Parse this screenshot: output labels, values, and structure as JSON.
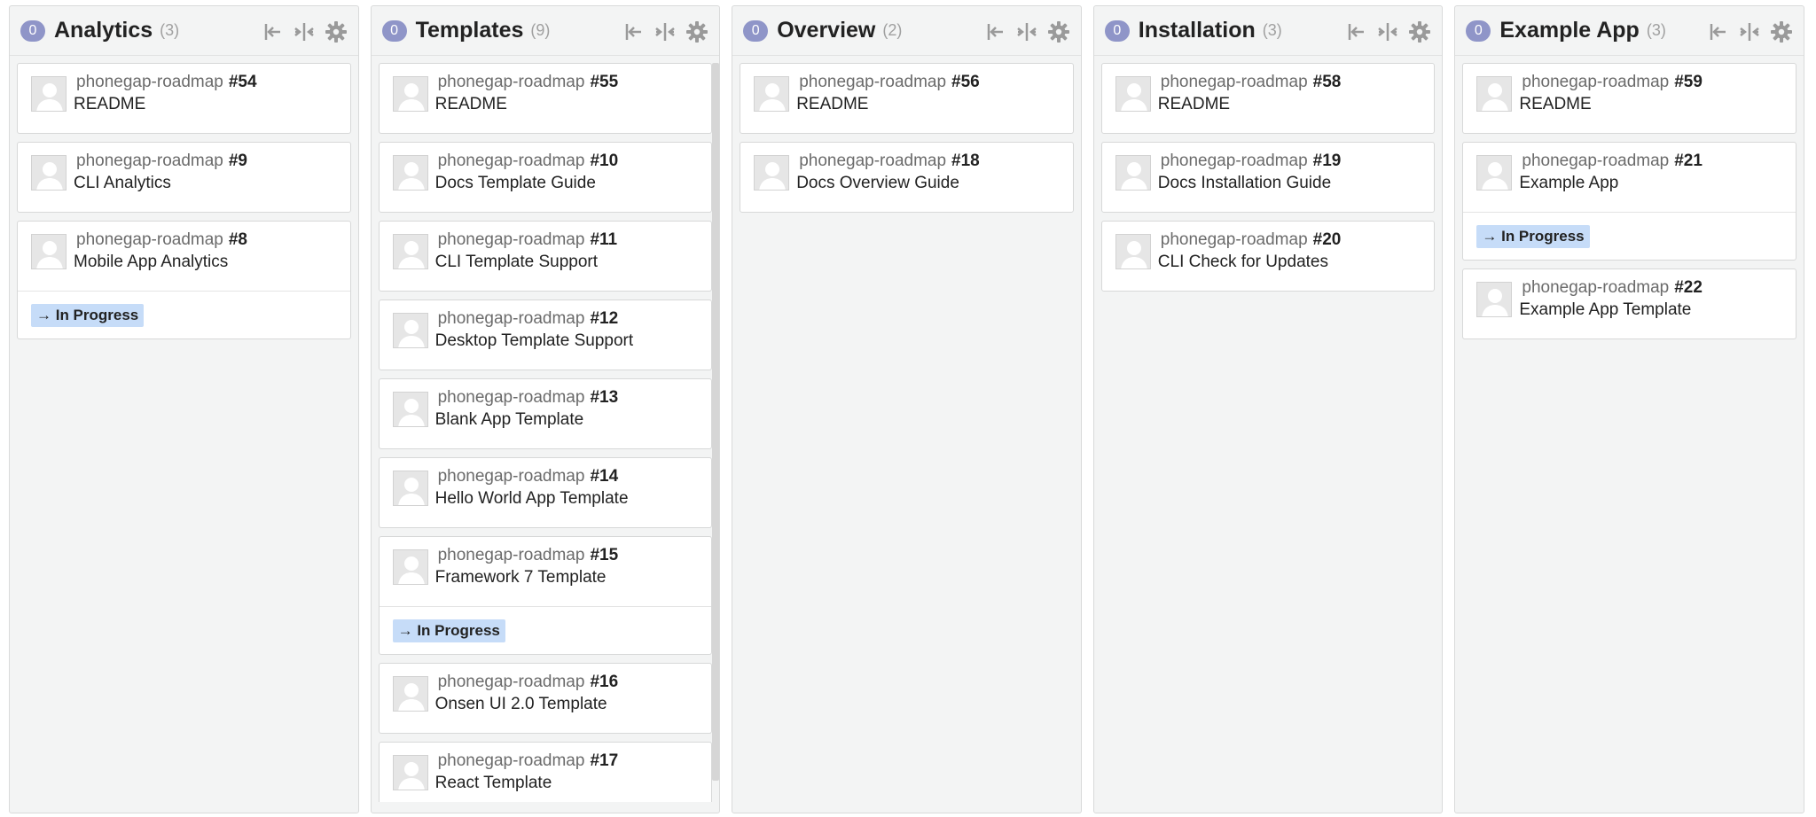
{
  "columns": [
    {
      "badge": "0",
      "title": "Analytics",
      "total": "(3)",
      "cards": [
        {
          "repo": "phonegap-roadmap",
          "number": "#54",
          "title": "README"
        },
        {
          "repo": "phonegap-roadmap",
          "number": "#9",
          "title": "CLI Analytics"
        },
        {
          "repo": "phonegap-roadmap",
          "number": "#8",
          "title": "Mobile App Analytics",
          "status": "→ In Progress"
        }
      ]
    },
    {
      "badge": "0",
      "title": "Templates",
      "total": "(9)",
      "cards": [
        {
          "repo": "phonegap-roadmap",
          "number": "#55",
          "title": "README"
        },
        {
          "repo": "phonegap-roadmap",
          "number": "#10",
          "title": "Docs Template Guide"
        },
        {
          "repo": "phonegap-roadmap",
          "number": "#11",
          "title": "CLI Template Support"
        },
        {
          "repo": "phonegap-roadmap",
          "number": "#12",
          "title": "Desktop Template Support"
        },
        {
          "repo": "phonegap-roadmap",
          "number": "#13",
          "title": "Blank App Template"
        },
        {
          "repo": "phonegap-roadmap",
          "number": "#14",
          "title": "Hello World App Template"
        },
        {
          "repo": "phonegap-roadmap",
          "number": "#15",
          "title": "Framework 7 Template",
          "status": "→ In Progress"
        },
        {
          "repo": "phonegap-roadmap",
          "number": "#16",
          "title": "Onsen UI 2.0 Template"
        },
        {
          "repo": "phonegap-roadmap",
          "number": "#17",
          "title": "React Template"
        }
      ]
    },
    {
      "badge": "0",
      "title": "Overview",
      "total": "(2)",
      "cards": [
        {
          "repo": "phonegap-roadmap",
          "number": "#56",
          "title": "README"
        },
        {
          "repo": "phonegap-roadmap",
          "number": "#18",
          "title": "Docs Overview Guide"
        }
      ]
    },
    {
      "badge": "0",
      "title": "Installation",
      "total": "(3)",
      "cards": [
        {
          "repo": "phonegap-roadmap",
          "number": "#58",
          "title": "README"
        },
        {
          "repo": "phonegap-roadmap",
          "number": "#19",
          "title": "Docs Installation Guide"
        },
        {
          "repo": "phonegap-roadmap",
          "number": "#20",
          "title": "CLI Check for Updates"
        }
      ]
    },
    {
      "badge": "0",
      "title": "Example App",
      "total": "(3)",
      "cards": [
        {
          "repo": "phonegap-roadmap",
          "number": "#59",
          "title": "README"
        },
        {
          "repo": "phonegap-roadmap",
          "number": "#21",
          "title": "Example App",
          "status": "→ In Progress"
        },
        {
          "repo": "phonegap-roadmap",
          "number": "#22",
          "title": "Example App Template"
        }
      ]
    }
  ],
  "icons": {
    "collapse": "collapse-left-icon",
    "compress": "compress-icon",
    "settings": "gear-icon",
    "avatar": "avatar-placeholder-icon"
  },
  "colors": {
    "badge": "#8f95c8",
    "status_pill": "#c6dcf8",
    "column_bg": "#f3f4f4"
  }
}
